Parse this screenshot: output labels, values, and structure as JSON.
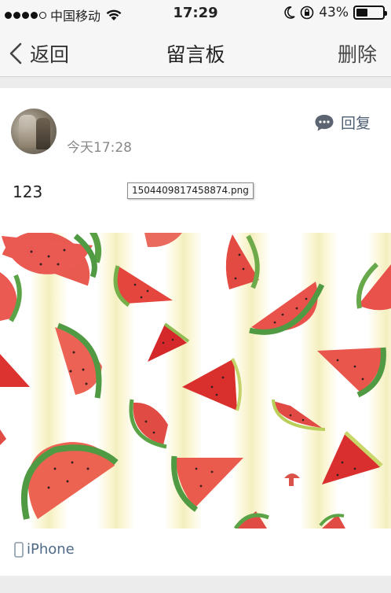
{
  "status_bar": {
    "carrier": "中国移动",
    "time": "17:29",
    "battery_percent": "43%",
    "battery_level": 0.43,
    "icons": [
      "signal-dots",
      "wifi-icon",
      "moon-icon",
      "rotation-lock-icon",
      "battery-icon"
    ]
  },
  "nav": {
    "back_label": "返回",
    "title": "留言板",
    "delete_label": "删除"
  },
  "post": {
    "time": "今天17:28",
    "reply_label": "回复",
    "text": "123",
    "attachment_filename": "1504409817458874.png",
    "source_label": "iPhone",
    "image_subject": "watermelon-slices-pattern"
  },
  "colors": {
    "link": "#4e6a86",
    "watermelon_red": "#e8473f",
    "rind_green": "#4f9a43"
  }
}
